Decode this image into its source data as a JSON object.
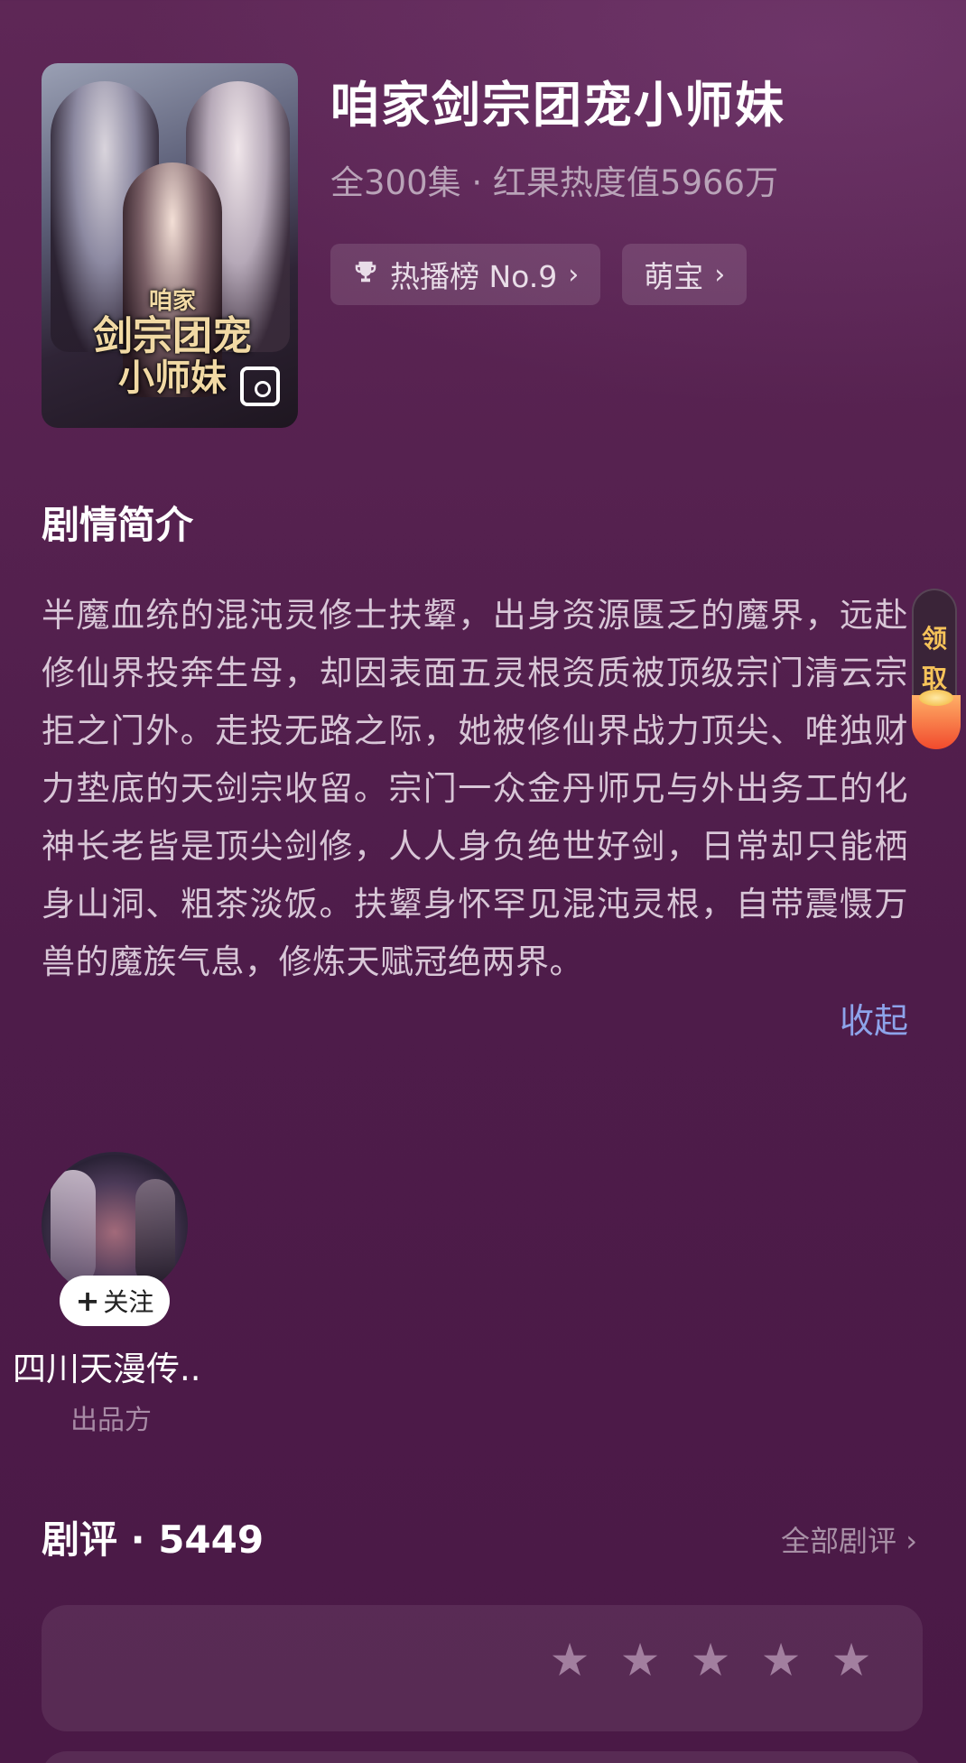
{
  "show": {
    "title": "咱家剑宗团宠小师妹",
    "subtitle": "全300集 · 红果热度值5966万",
    "cover_art_text": [
      "咱家",
      "剑宗团宠",
      "小师妹"
    ],
    "tags": [
      {
        "icon": "trophy-icon",
        "label": "热播榜 No.9"
      },
      {
        "label": "萌宝"
      }
    ]
  },
  "synopsis": {
    "heading": "剧情简介",
    "text": "半魔血统的混沌灵修士扶颦，出身资源匮乏的魔界，远赴修仙界投奔生母，却因表面五灵根资质被顶级宗门清云宗拒之门外。走投无路之际，她被修仙界战力顶尖、唯独财力垫底的天剑宗收留。宗门一众金丹师兄与外出务工的化神长老皆是顶尖剑修，人人身负绝世好剑，日常却只能栖身山洞、粗茶淡饭。扶颦身怀罕见混沌灵根，自带震慑万兽的魔族气息，修炼天赋冠绝两界。",
    "collapse_label": "收起"
  },
  "reward": {
    "label_line1": "领",
    "label_line2": "取"
  },
  "producer": {
    "follow_label": "关注",
    "name": "四川天漫传..",
    "role": "出品方"
  },
  "reviews": {
    "title": "剧评 · 5449",
    "all_label": "全部剧评 ›",
    "star_count": 5
  },
  "colors": {
    "background": "#55214f",
    "accent_link": "#8da3ea",
    "reward_text": "#f6c35a"
  }
}
